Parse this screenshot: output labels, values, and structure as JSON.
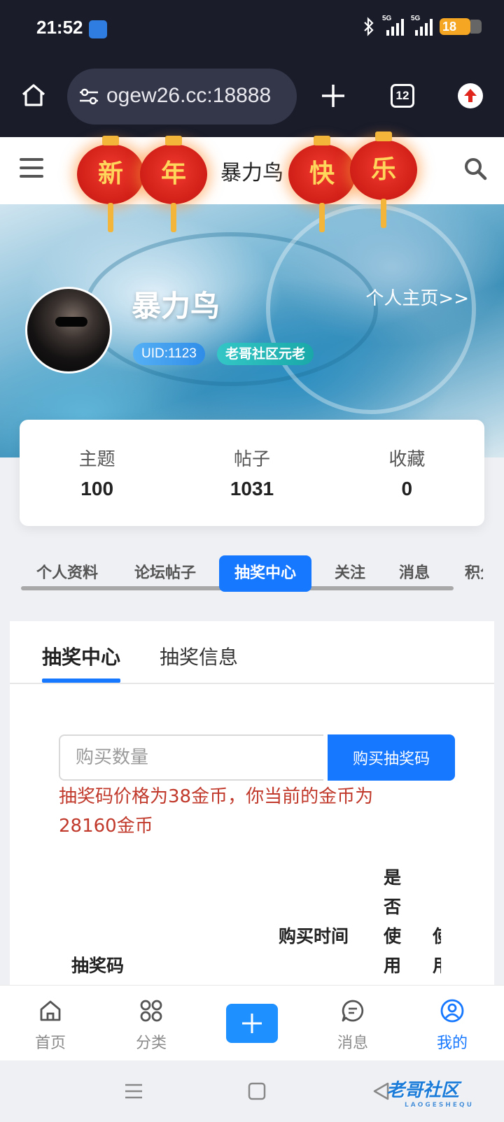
{
  "status_bar": {
    "time": "21:52",
    "network_1": "5G",
    "network_2": "5G",
    "battery": "18"
  },
  "browser": {
    "url": "ogew26.cc:18888",
    "tab_count": "12"
  },
  "site": {
    "title": "暴力鸟",
    "lanterns": [
      "新",
      "年",
      "快",
      "乐"
    ]
  },
  "profile": {
    "name": "暴力鸟",
    "home_link": "个人主页>>",
    "uid": "UID:1123",
    "title_badge": "老哥社区元老"
  },
  "stats": [
    {
      "label": "主题",
      "value": "100"
    },
    {
      "label": "帖子",
      "value": "1031"
    },
    {
      "label": "收藏",
      "value": "0"
    }
  ],
  "section_tabs": [
    "个人资料",
    "论坛帖子",
    "抽奖中心",
    "关注",
    "消息",
    "积分"
  ],
  "content": {
    "tabs": [
      "抽奖中心",
      "抽奖信息"
    ],
    "quantity_placeholder": "购买数量",
    "buy_button": "购买抽奖码",
    "price_note": "抽奖码价格为38金币，你当前的金币为28160金币",
    "table_headers": [
      "抽奖码",
      "购买时间",
      "是否使用",
      "使用时间"
    ]
  },
  "bottom_nav": [
    {
      "label": "首页",
      "icon": "home-icon"
    },
    {
      "label": "分类",
      "icon": "grid-icon"
    },
    {
      "label": "消息",
      "icon": "chat-icon"
    },
    {
      "label": "我的",
      "icon": "user-icon"
    }
  ],
  "watermark": {
    "text": "老哥社区",
    "sub": "LAOGESHEQU"
  },
  "colors": {
    "accent": "#1677ff",
    "warning_text": "#c0392b",
    "dark_bar": "#1a1c2a"
  }
}
